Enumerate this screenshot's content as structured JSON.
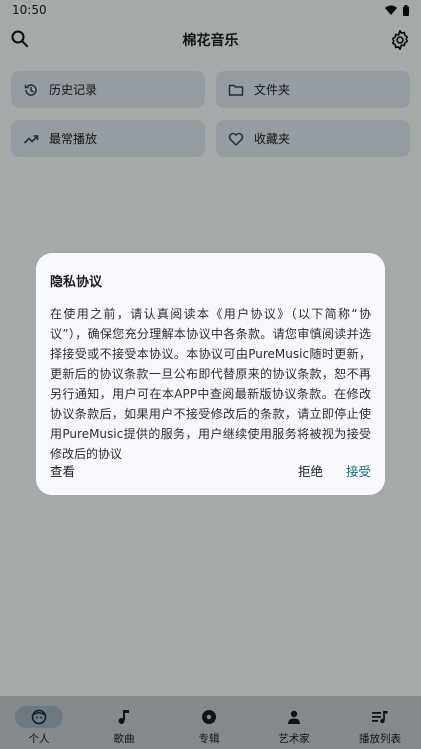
{
  "status": {
    "time": "10:50"
  },
  "topbar": {
    "title": "棉花音乐"
  },
  "cards": [
    {
      "label": "历史记录",
      "icon": "history-icon"
    },
    {
      "label": "文件夹",
      "icon": "folder-icon"
    },
    {
      "label": "最常播放",
      "icon": "trending-icon"
    },
    {
      "label": "收藏夹",
      "icon": "heart-icon"
    }
  ],
  "dialog": {
    "title": "隐私协议",
    "body": "在使用之前，请认真阅读本《用户协议》（以下简称“协议”），确保您充分理解本协议中各条款。请您审慎阅读并选择接受或不接受本协议。本协议可由PureMusic随时更新，更新后的协议条款一旦公布即代替原来的协议条款，恕不再另行通知，用户可在本APP中查阅最新版协议条款。在修改协议条款后，如果用户不接受修改后的条款，请立即停止使用PureMusic提供的服务，用户继续使用服务将被视为接受修改后的协议",
    "view": "查看",
    "reject": "拒绝",
    "accept": "接受"
  },
  "nav": [
    {
      "label": "个人",
      "icon": "face-icon",
      "active": true
    },
    {
      "label": "歌曲",
      "icon": "music-note-icon"
    },
    {
      "label": "专辑",
      "icon": "album-icon"
    },
    {
      "label": "艺术家",
      "icon": "person-icon"
    },
    {
      "label": "播放列表",
      "icon": "playlist-icon"
    }
  ],
  "colors": {
    "accent": "#1a6a86",
    "card_bg": "#dde8ef",
    "nav_bg": "#c6cbce"
  }
}
